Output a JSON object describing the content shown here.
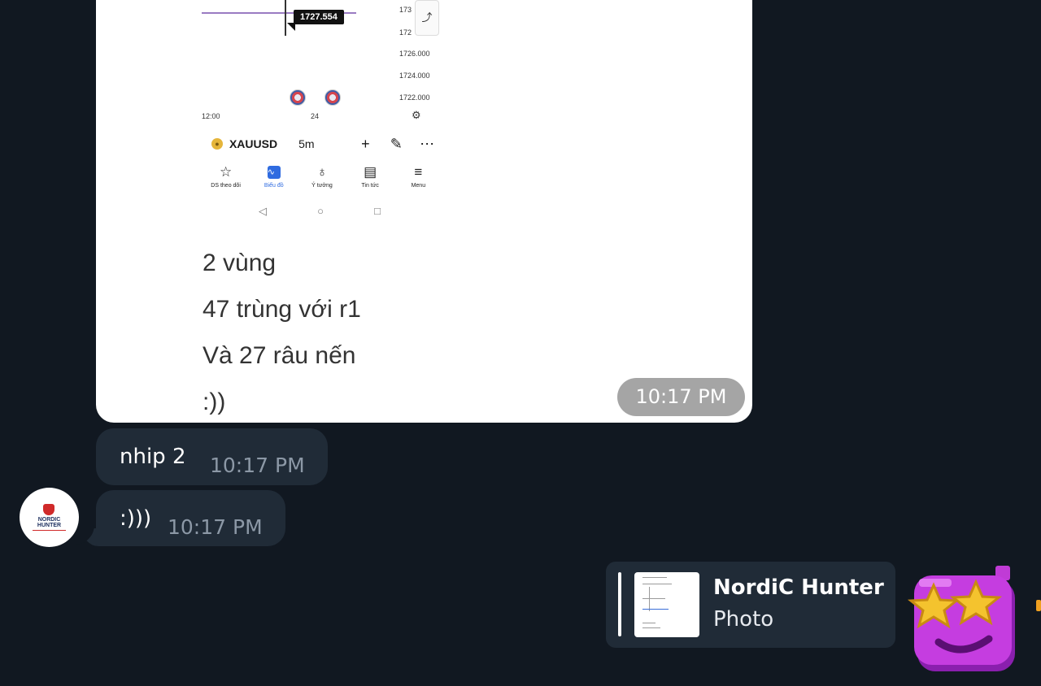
{
  "photo_message": {
    "screenshot": {
      "crosshair_price": "1727.554",
      "price_axis": [
        "173",
        "172",
        "1726.000",
        "1724.000",
        "1722.000"
      ],
      "time_axis": [
        "12:00",
        "24"
      ],
      "symbol": "XAUUSD",
      "timeframe": "5m",
      "bottom_nav": [
        {
          "label": "DS theo dõi",
          "icon": "star-icon"
        },
        {
          "label": "Biểu đồ",
          "icon": "chart-icon"
        },
        {
          "label": "Ý tưởng",
          "icon": "lightbulb-icon"
        },
        {
          "label": "Tin tức",
          "icon": "news-icon"
        },
        {
          "label": "Menu",
          "icon": "menu-icon"
        }
      ]
    },
    "caption_lines": [
      "2 vùng",
      "47 trùng với r1",
      "Và 27 râu nến",
      ":))"
    ],
    "time": "10:17 PM"
  },
  "messages": [
    {
      "text": "nhip 2",
      "time": "10:17 PM"
    },
    {
      "text": ":)))",
      "time": "10:17 PM"
    }
  ],
  "avatar": {
    "line1": "NORDIC",
    "line2": "HUNTER"
  },
  "reply_preview": {
    "sender": "NordiC Hunter",
    "kind": "Photo"
  },
  "sticker": {
    "icon": "star-eyes-sticker"
  },
  "colors": {
    "background": "#111821",
    "bubble": "#202b37",
    "time_text": "#8c98a6"
  }
}
